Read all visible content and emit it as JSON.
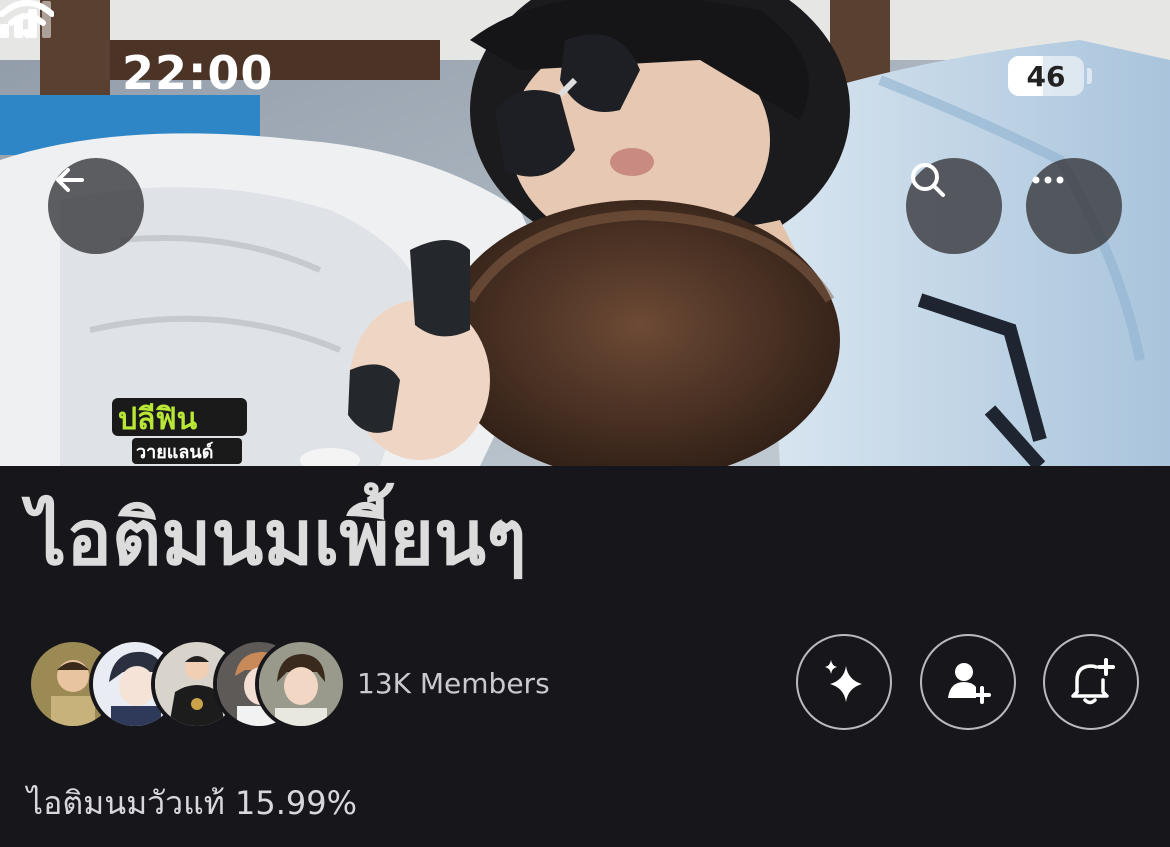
{
  "status_bar": {
    "time": "22:00",
    "battery": "46",
    "battery_level_percent": 46,
    "icons": [
      "cellular-signal-icon",
      "wifi-icon",
      "battery-icon"
    ]
  },
  "header": {
    "buttons": [
      "back-arrow-icon",
      "search-icon",
      "more-dots-icon"
    ]
  },
  "cover": {
    "logo_text": [
      "ปลีฟิน",
      "วายแลนด์"
    ],
    "colors": {
      "logo_green": "#b8e835",
      "logo_outline": "#1a1a1a"
    }
  },
  "group": {
    "title": "ไอติมนมเพี้ยนๆ",
    "members_count": "13K Members",
    "description": "ไอติมนมวัวแท้ 15.99%"
  },
  "actions": [
    "sparkle-icon",
    "add-person-icon",
    "bell-plus-icon"
  ],
  "theme": {
    "background": "#17171b",
    "text_primary": "#dcdcdc",
    "text_secondary": "#c9c9cf",
    "button_border": "#b9b9bf"
  }
}
